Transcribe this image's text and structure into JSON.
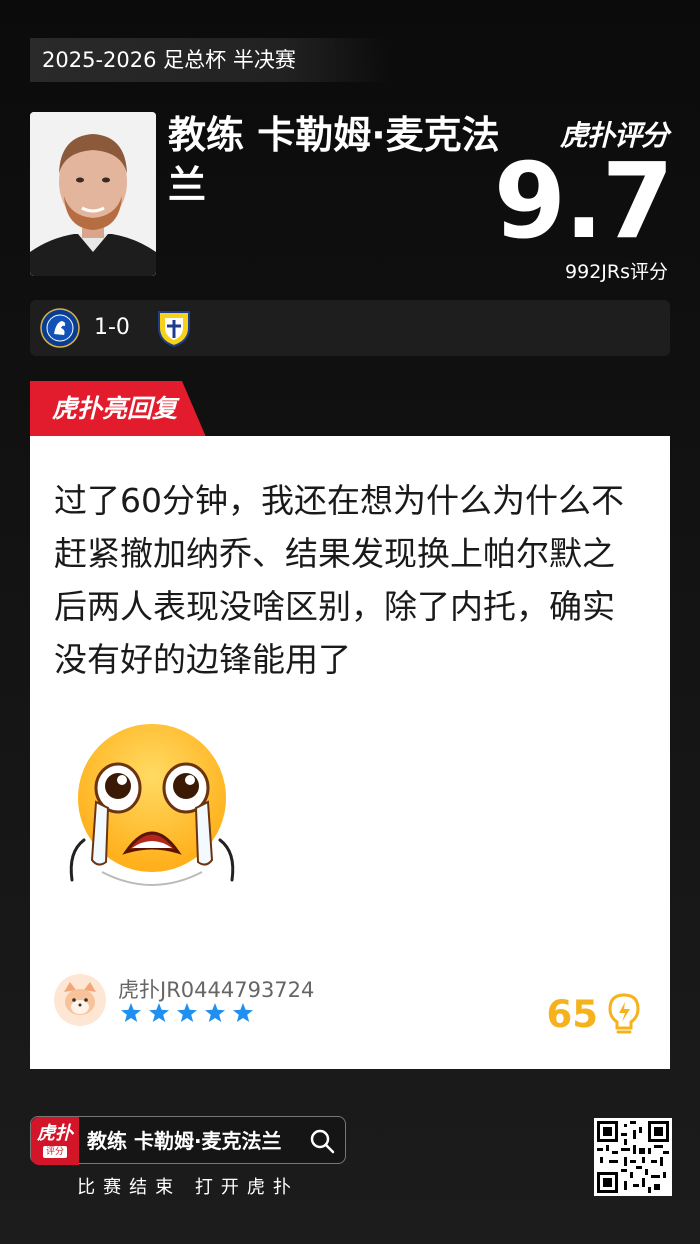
{
  "header": {
    "competition": "2025-2026 足总杯 半决赛",
    "coach_name": "教练 卡勒姆·麦克法兰",
    "brand_rating": "虎扑评分",
    "score": "9.7",
    "votes": "992JRs评分"
  },
  "match": {
    "score": "1-0",
    "home_badge_icon": "chelsea-badge-icon",
    "away_badge_icon": "leeds-badge-icon"
  },
  "comment": {
    "tab_label": "虎扑亮回复",
    "text": "过了60分钟，我还在想为什么为什么不赶紧撤加纳乔、结果发现换上帕尔默之后两人表现没啥区别，除了内托，确实没有好的边锋能用了",
    "emoji_icon": "crying-face-emoji",
    "username": "虎扑JR0444793724",
    "stars": 5,
    "likes": "65"
  },
  "footer": {
    "search_text": "教练 卡勒姆·麦克法兰",
    "app_logo_top": "虎扑",
    "app_logo_bottom": "评分",
    "cta": "比赛结束 打开虎扑"
  },
  "colors": {
    "accent_red": "#d3152a",
    "like_gold": "#f5b21a",
    "star_blue": "#1f8ff0"
  }
}
